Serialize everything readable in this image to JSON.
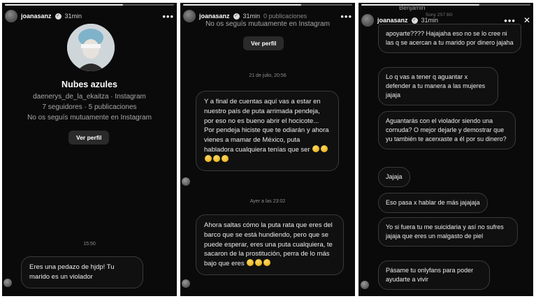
{
  "panel1": {
    "header": {
      "username": "joanasanz",
      "time": "31min"
    },
    "profile": {
      "name": "Nubes azules",
      "handle_line": "daenerys_de_la_ekaitza · Instagram",
      "stats_line": "7 seguidores · 5 publicaciones",
      "mutual_line": "No os seguís mutuamente en Instagram",
      "view_profile_label": "Ver perfil"
    },
    "timestamp": "15:50",
    "message": "Eres una pedazo de hjdp! Tu marido es un violador"
  },
  "panel2": {
    "header": {
      "username": "joanasanz",
      "time": "31min",
      "ghost_text": "0 publicaciones"
    },
    "mutual_line": "No os seguís mutuamente en Instagram",
    "view_profile_label": "Ver perfil",
    "timestamp1": "21 de julio, 20:56",
    "message1": "Y a final de cuentas aquí vas a estar en nuestro país de puta arrimada pendeja, por eso no es bueno abrir el hocicote... Por pendeja hiciste que te odiarán y ahora vienes a mamar de México, puta habladora cualquiera tenías que ser",
    "timestamp2": "Ayer a las 23:02",
    "message2": "Ahora saltas cómo la puta rata que eres del barco que se está hundiendo, pero que se puede esperar, eres una puta cualquiera, te sacaron de la prostitución, perra de lo más bajo que eres"
  },
  "panel3": {
    "header": {
      "username": "joanasanz",
      "time": "31min",
      "ghost_name": "Benjamin",
      "ghost_time": "Sony 2S7 8G"
    },
    "messages": [
      "apoyarte???? Hajajaha eso no se lo cree ni las q se acercan a tu marido por dinero jajaha",
      "Lo q vas a tener q aguantar x defender a tu manera a las mujeres jajaja",
      "Aguantarás con el violador siendo una cornuda? O mejor dejarle y demostrar que yu también te acerxaste a él por su dinero?",
      "Jajaja",
      "Eso pasa x hablar de más jajajaja",
      "Yo si fuera tu me suicidaria y así no sufres jajaja que eres un malgasto de piel",
      "Pásame tu onlyfans para poder ayudarte a vivir"
    ]
  },
  "icons": {
    "more": "more-options-icon",
    "close": "close-icon",
    "verified": "verified-badge-icon"
  }
}
